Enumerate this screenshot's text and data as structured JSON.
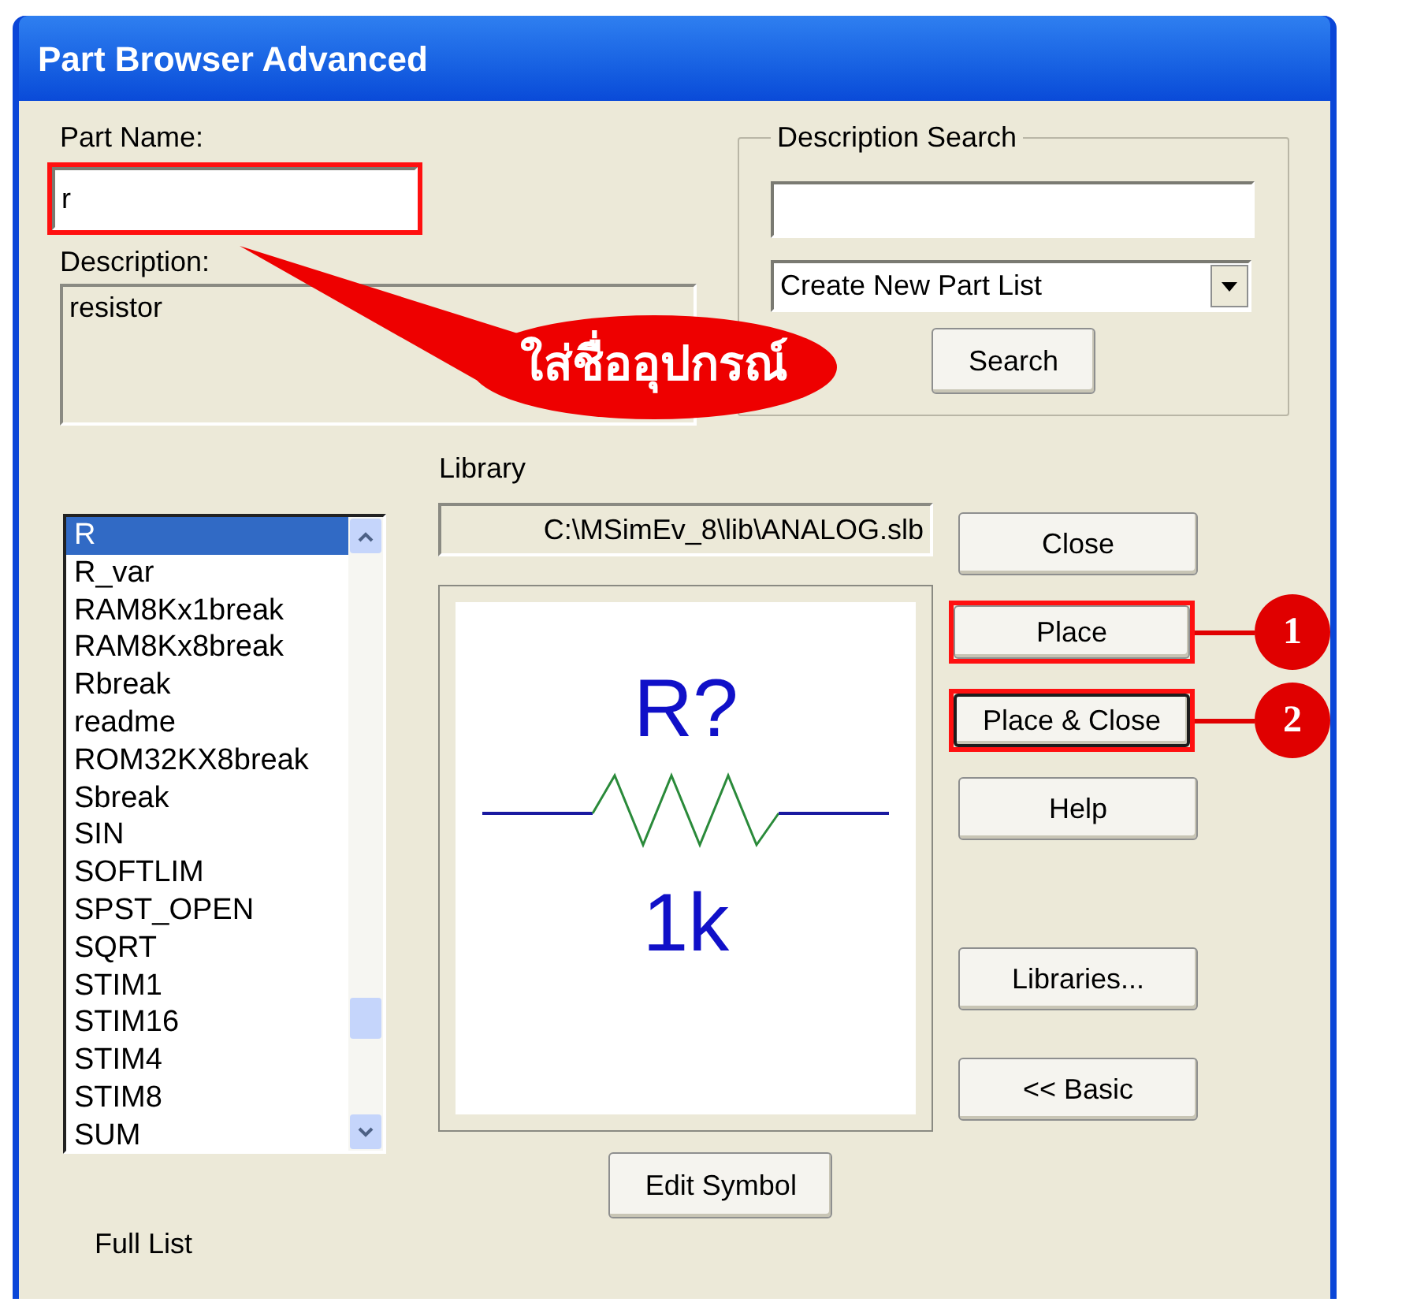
{
  "window": {
    "title": "Part Browser Advanced"
  },
  "part_name": {
    "label": "Part Name:",
    "value": "r",
    "highlighted": true
  },
  "description": {
    "label": "Description:",
    "value": "resistor"
  },
  "description_search": {
    "title": "Description Search",
    "dropdown": "Create New Part List",
    "button": "Search"
  },
  "parts_list": {
    "items": [
      {
        "label": "R",
        "selected": true
      },
      {
        "label": "R_var",
        "selected": false
      },
      {
        "label": "RAM8Kx1break",
        "selected": false
      },
      {
        "label": "RAM8Kx8break",
        "selected": false
      },
      {
        "label": "Rbreak",
        "selected": false
      },
      {
        "label": "readme",
        "selected": false
      },
      {
        "label": "ROM32KX8break",
        "selected": false
      },
      {
        "label": "Sbreak",
        "selected": false
      },
      {
        "label": "SIN",
        "selected": false
      },
      {
        "label": "SOFTLIM",
        "selected": false
      },
      {
        "label": "SPST_OPEN",
        "selected": false
      },
      {
        "label": "SQRT",
        "selected": false
      },
      {
        "label": "STIM1",
        "selected": false
      },
      {
        "label": "STIM16",
        "selected": false
      },
      {
        "label": "STIM4",
        "selected": false
      },
      {
        "label": "STIM8",
        "selected": false
      },
      {
        "label": "SUM",
        "selected": false
      }
    ],
    "footer": "Full List"
  },
  "library": {
    "label": "Library",
    "path": "C:\\MSimEv_8\\lib\\ANALOG.slb"
  },
  "preview": {
    "reference": "R?",
    "value": "1k"
  },
  "edit_button": "Edit Symbol",
  "button_groups": [
    [
      {
        "label": "Close",
        "highlighted": false,
        "default": false
      },
      {
        "label": "Place",
        "highlighted": true,
        "default": false,
        "marker": "1"
      },
      {
        "label": "Place & Close",
        "highlighted": true,
        "default": true,
        "marker": "2"
      },
      {
        "label": "Help",
        "highlighted": false,
        "default": false
      }
    ],
    [
      {
        "label": "Libraries...",
        "highlighted": false,
        "default": false
      },
      {
        "label": "<< Basic",
        "highlighted": false,
        "default": false
      }
    ]
  ],
  "callout": {
    "text": "ใส่ชื่ออุปกรณ์"
  }
}
